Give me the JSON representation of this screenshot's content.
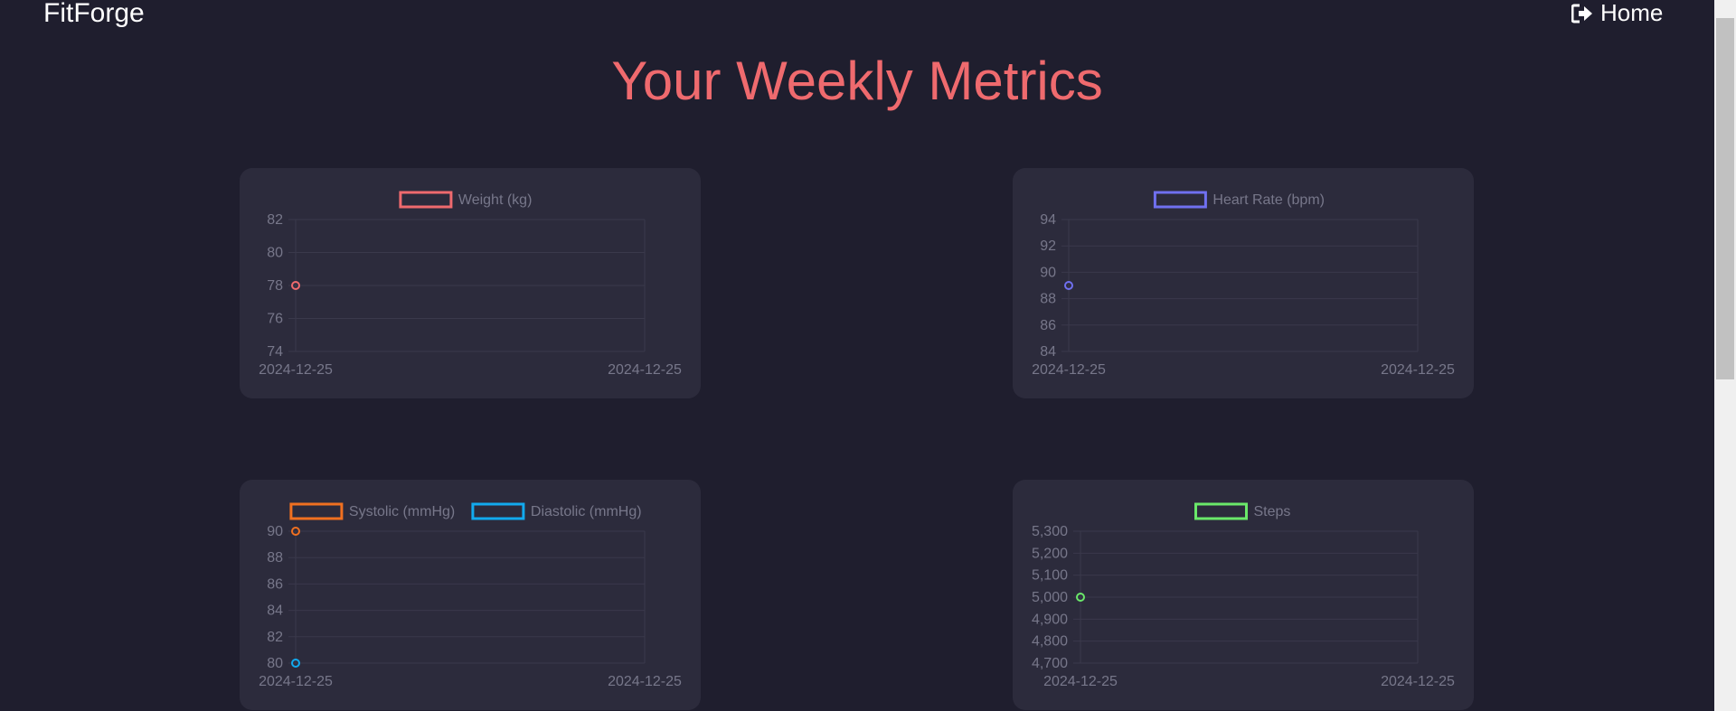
{
  "header": {
    "brand": "FitForge",
    "home_label": "Home"
  },
  "page_title": "Your Weekly Metrics",
  "colors": {
    "background": "#1f1e2e",
    "card": "#2c2b3c",
    "title": "#ef6a6e",
    "axis_text": "#77778a",
    "grid": "#3a394b"
  },
  "chart_data": [
    {
      "type": "line",
      "legend_position": "top",
      "series": [
        {
          "name": "Weight (kg)",
          "color": "#ef6a6e",
          "points": [
            {
              "x": "2024-12-25",
              "y": 78
            }
          ]
        }
      ],
      "x_ticks": [
        "2024-12-25",
        "2024-12-25"
      ],
      "y_ticks": [
        "82",
        "80",
        "78",
        "76",
        "74"
      ],
      "ylim": [
        74,
        82
      ],
      "grid": true
    },
    {
      "type": "line",
      "legend_position": "top",
      "series": [
        {
          "name": "Heart Rate (bpm)",
          "color": "#7070f0",
          "points": [
            {
              "x": "2024-12-25",
              "y": 89
            }
          ]
        }
      ],
      "x_ticks": [
        "2024-12-25",
        "2024-12-25"
      ],
      "y_ticks": [
        "94",
        "92",
        "90",
        "88",
        "86",
        "84"
      ],
      "ylim": [
        84,
        94
      ],
      "grid": true
    },
    {
      "type": "line",
      "legend_position": "top",
      "series": [
        {
          "name": "Systolic (mmHg)",
          "color": "#f07020",
          "points": [
            {
              "x": "2024-12-25",
              "y": 90
            }
          ]
        },
        {
          "name": "Diastolic (mmHg)",
          "color": "#12aaee",
          "points": [
            {
              "x": "2024-12-25",
              "y": 80
            }
          ]
        }
      ],
      "x_ticks": [
        "2024-12-25",
        "2024-12-25"
      ],
      "y_ticks": [
        "90",
        "88",
        "86",
        "84",
        "82",
        "80"
      ],
      "ylim": [
        80,
        90
      ],
      "grid": true
    },
    {
      "type": "line",
      "legend_position": "top",
      "series": [
        {
          "name": "Steps",
          "color": "#6ae86a",
          "points": [
            {
              "x": "2024-12-25",
              "y": 5000
            }
          ]
        }
      ],
      "x_ticks": [
        "2024-12-25",
        "2024-12-25"
      ],
      "y_ticks": [
        "5,300",
        "5,200",
        "5,100",
        "5,000",
        "4,900",
        "4,800",
        "4,700"
      ],
      "ylim": [
        4700,
        5300
      ],
      "grid": true
    }
  ]
}
